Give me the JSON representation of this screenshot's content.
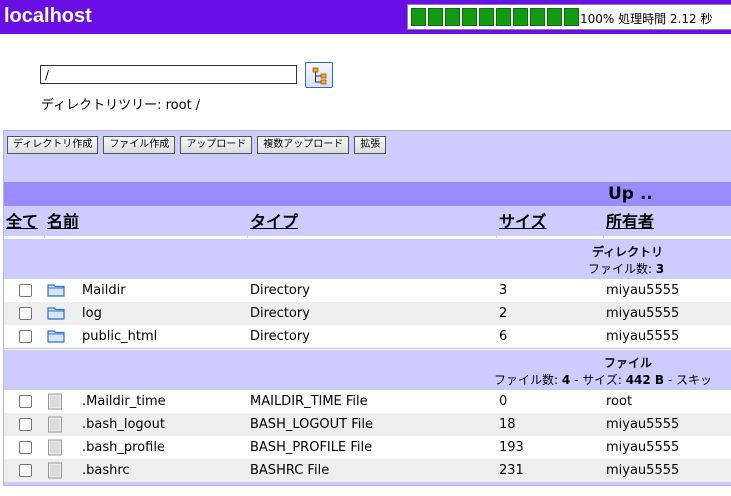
{
  "header": {
    "title": "localhost",
    "progress_blocks": 10,
    "progress_percent": 100,
    "progress_text": "100% 処理時間 2.12 秒"
  },
  "path": {
    "value": "/",
    "tree_line": "ディレクトリツリー: root /"
  },
  "toolbar": {
    "mkdir": "ディレクトリ作成",
    "mkfile": "ファイル作成",
    "upload": "アップロード",
    "multi_upload": "複数アップロード",
    "extend": "拡張"
  },
  "up_label": "Up ..",
  "columns": {
    "all": "全て",
    "name": "名前",
    "type": "タイプ",
    "size": "サイズ",
    "owner": "所有者"
  },
  "dir_section": {
    "title": "ディレクトリ",
    "count_label": "ファイル数: ",
    "count": "3"
  },
  "directories": [
    {
      "name": "Maildir",
      "type": "Directory",
      "size": "3",
      "owner": "miyau5555"
    },
    {
      "name": "log",
      "type": "Directory",
      "size": "2",
      "owner": "miyau5555"
    },
    {
      "name": "public_html",
      "type": "Directory",
      "size": "6",
      "owner": "miyau5555"
    }
  ],
  "file_section": {
    "title": "ファイル",
    "count_label": "ファイル数: ",
    "count": "4",
    "size_label": " - サイズ: ",
    "size": "442 B",
    "tail": " - スキッ"
  },
  "files": [
    {
      "name": ".Maildir_time",
      "type": "MAILDIR_TIME File",
      "size": "0",
      "owner": "root"
    },
    {
      "name": ".bash_logout",
      "type": "BASH_LOGOUT File",
      "size": "18",
      "owner": "miyau5555"
    },
    {
      "name": ".bash_profile",
      "type": "BASH_PROFILE File",
      "size": "193",
      "owner": "miyau5555"
    },
    {
      "name": ".bashrc",
      "type": "BASHRC File",
      "size": "231",
      "owner": "miyau5555"
    }
  ],
  "colors": {
    "header_bg": "#6a0ee6",
    "progress_green": "#139a13",
    "panel_bg": "#ccccff",
    "up_row_bg": "#9a8cff",
    "folder_blue": "#2f6fd8"
  }
}
